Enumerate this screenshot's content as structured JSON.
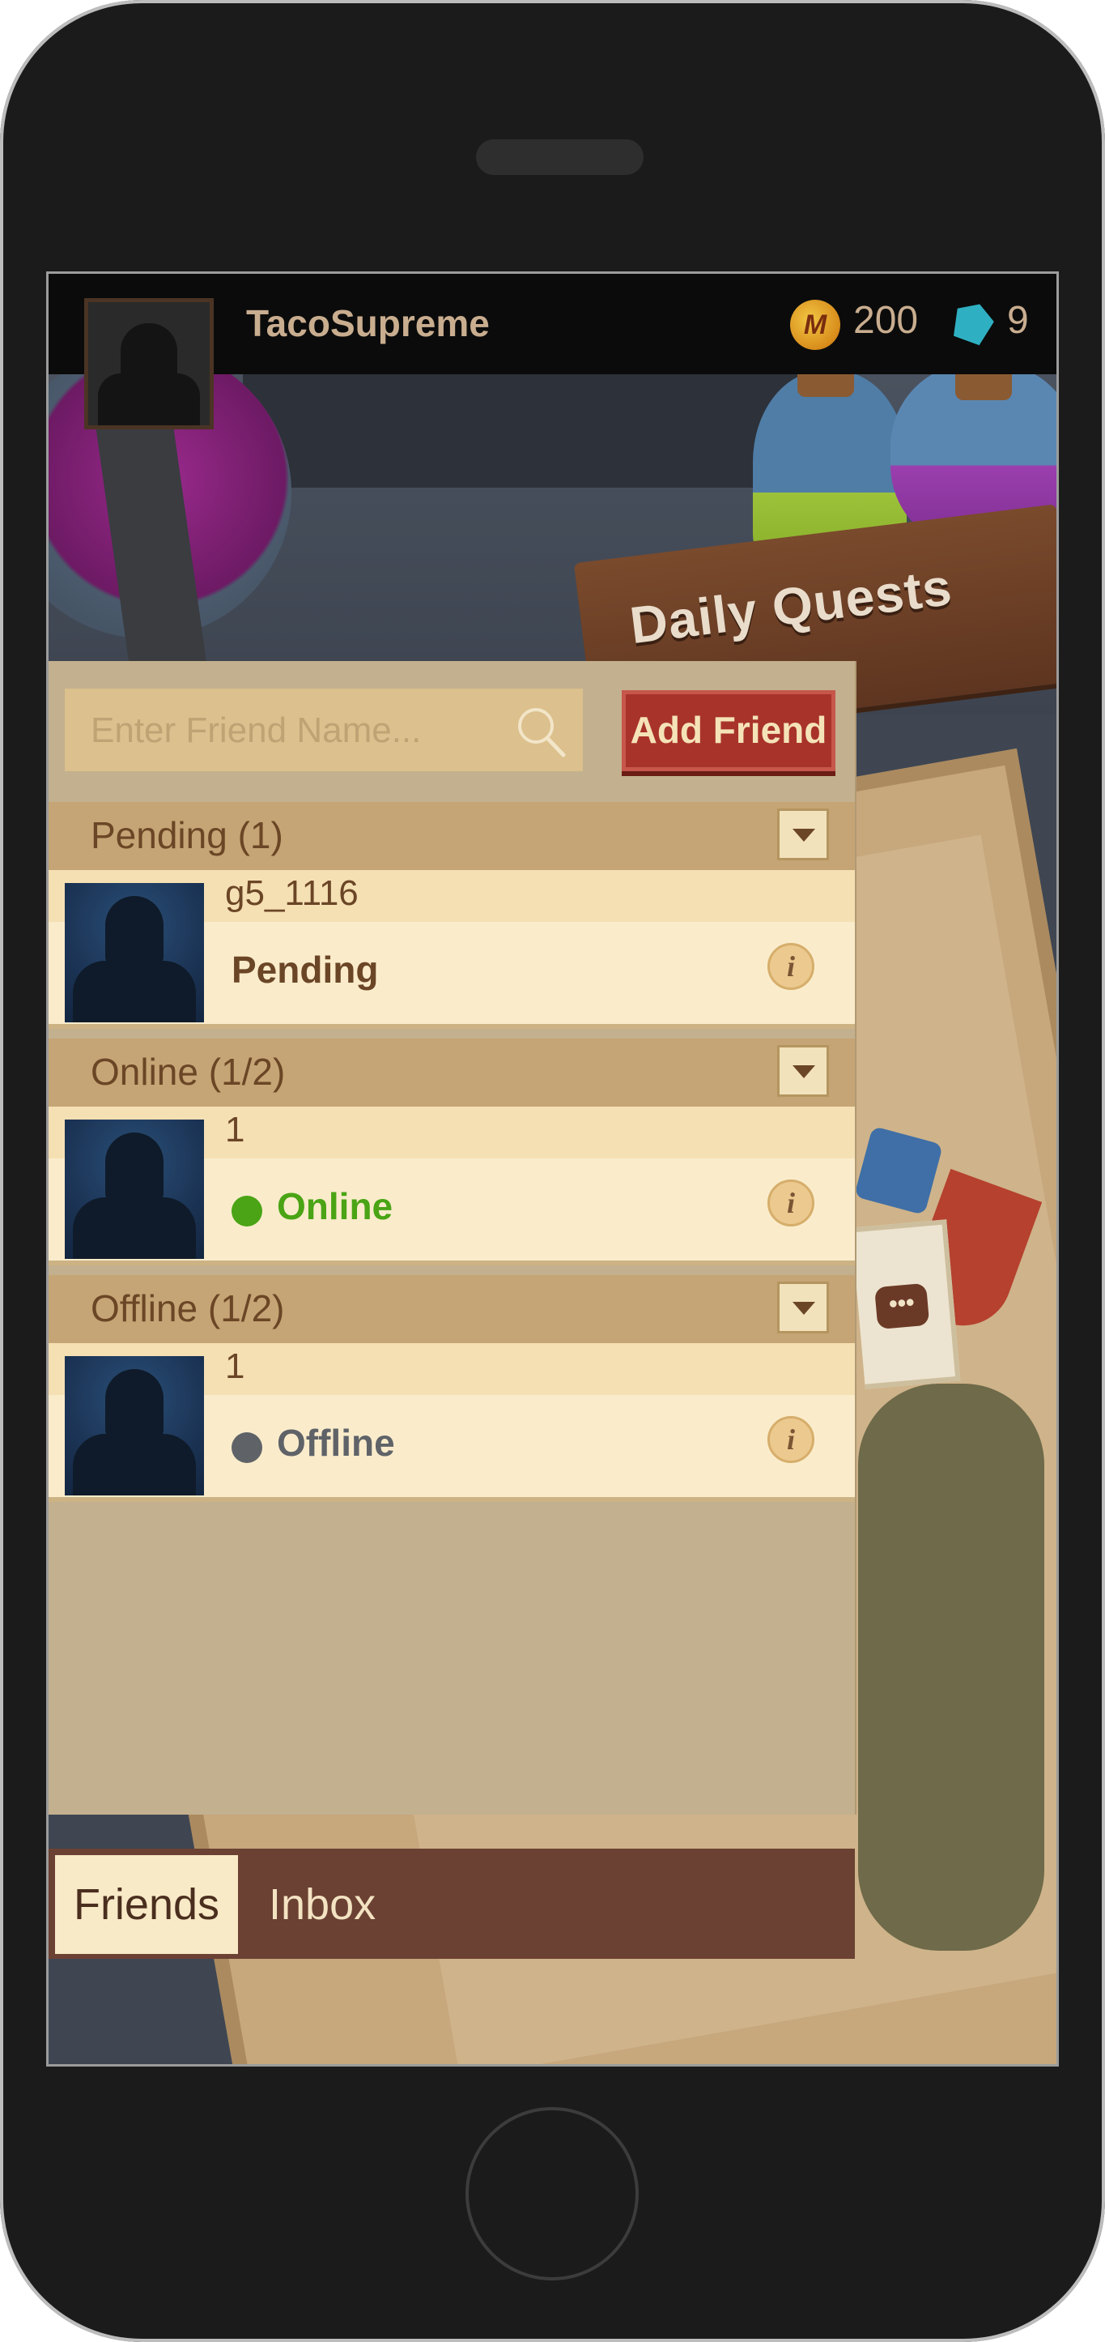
{
  "header": {
    "username": "TacoSupreme",
    "coin_symbol": "M",
    "coins": "200",
    "gems": "9"
  },
  "background": {
    "sign_text": "Daily Quests"
  },
  "friends_panel": {
    "search": {
      "placeholder": "Enter Friend Name..."
    },
    "add_friend_label": "Add Friend",
    "sections": [
      {
        "title": "Pending (1)",
        "friends": [
          {
            "name": "g5_1116",
            "status": "Pending"
          }
        ]
      },
      {
        "title": "Online (1/2)",
        "friends": [
          {
            "name": "1",
            "status": "Online"
          }
        ]
      },
      {
        "title": "Offline (1/2)",
        "friends": [
          {
            "name": "1",
            "status": "Offline"
          }
        ]
      }
    ],
    "info_symbol": "i"
  },
  "tabs": [
    {
      "label": "Friends",
      "active": true
    },
    {
      "label": "Inbox",
      "active": false
    }
  ],
  "colors": {
    "online": "#4aa415",
    "offline": "#5f6368",
    "pending_text": "#6b4626",
    "button_red": "#a8332a"
  },
  "chat_icon_text": "•••"
}
